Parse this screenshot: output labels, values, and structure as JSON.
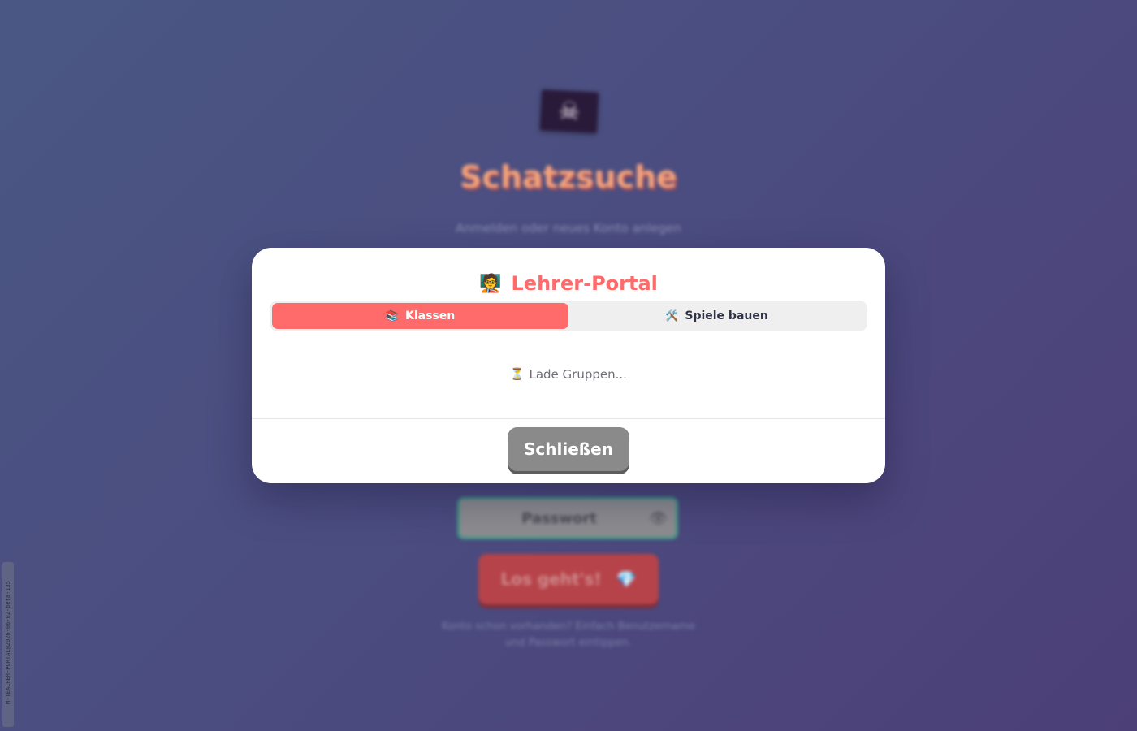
{
  "background": {
    "title": "Schatzsuche",
    "subtitle": "Anmelden oder neues Konto anlegen",
    "password_placeholder": "Passwort",
    "login_button": "Los geht's!",
    "hint": "Konto schon vorhanden? Einfach Benutzername und Passwort eintippen.",
    "version_tag": "M-TEACHER-PORTAL@2026-06-02-beta-135",
    "icons": {
      "flag": "pirate-flag-icon",
      "eye": "eye-icon",
      "gem": "gem-icon"
    }
  },
  "modal": {
    "icon": "🧑‍🏫",
    "title": "Lehrer-Portal",
    "tabs": [
      {
        "icon": "📚",
        "label": "Klassen",
        "active": true
      },
      {
        "icon": "🛠️",
        "label": "Spiele bauen",
        "active": false
      }
    ],
    "loading_icon": "⏳",
    "loading_text": "Lade Gruppen...",
    "close_label": "Schließen"
  },
  "colors": {
    "accent": "#ff6b6b",
    "close_button": "#8a8a8a",
    "background_start": "#4a5784",
    "background_end": "#4c3f78"
  }
}
